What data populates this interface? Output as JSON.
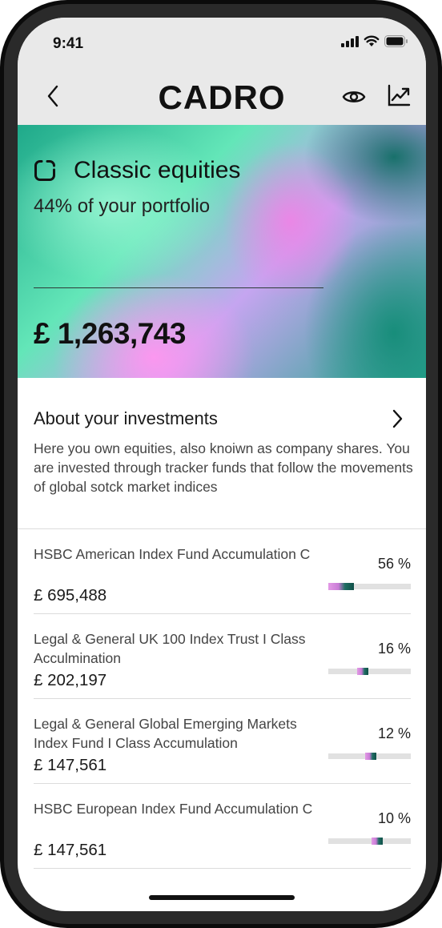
{
  "status_bar": {
    "time": "9:41"
  },
  "header": {
    "logo": "CADRO"
  },
  "hero": {
    "title": "Classic equities",
    "subtitle": "44% of your portfolio",
    "amount": "£ 1,263,743"
  },
  "about": {
    "title": "About your investments",
    "text": "Here you own equities, also knoiwn as company shares. You are invested through tracker funds that follow the movements of global sotck market indices"
  },
  "funds": [
    {
      "name": "HSBC American Index Fund Accumulation C",
      "value": "£ 695,488",
      "percent": "56 %",
      "share": 0.56
    },
    {
      "name": "Legal & General UK 100 Index Trust I Class Acculmination",
      "value": "£ 202,197",
      "percent": "16 %",
      "share": 0.16
    },
    {
      "name": "Legal & General Global Emerging Markets Index Fund I Class Accumulation",
      "value": "£ 147,561",
      "percent": "12 %",
      "share": 0.12
    },
    {
      "name": "HSBC European Index Fund Accumulation C",
      "value": "£ 147,561",
      "percent": "10 %",
      "share": 0.1
    }
  ],
  "colors": {
    "bar_track": "#e1e1e1",
    "bar_pink": "#e39ae6",
    "bar_teal": "#0f4f47"
  }
}
